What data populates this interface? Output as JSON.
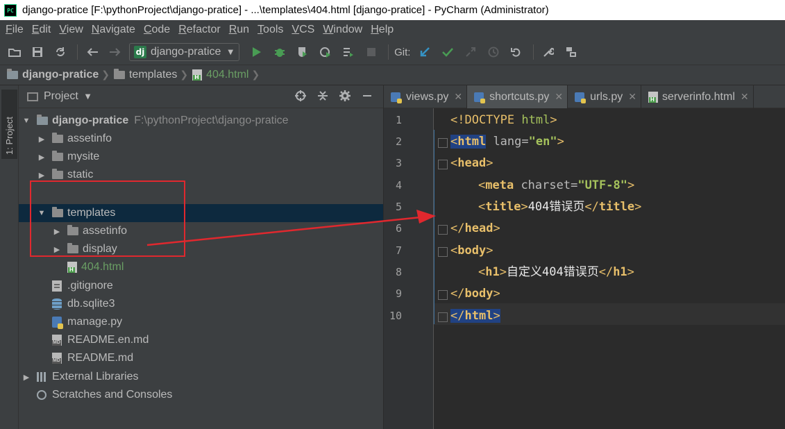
{
  "window": {
    "title": "django-pratice [F:\\pythonProject\\django-pratice] - ...\\templates\\404.html [django-pratice] - PyCharm (Administrator)",
    "app_logo_text": "PC"
  },
  "menu": [
    "File",
    "Edit",
    "View",
    "Navigate",
    "Code",
    "Refactor",
    "Run",
    "Tools",
    "VCS",
    "Window",
    "Help"
  ],
  "toolbar": {
    "run_config_badge": "dj",
    "run_config": "django-pratice",
    "git_label": "Git:"
  },
  "breadcrumb": [
    "django-pratice",
    "templates",
    "404.html"
  ],
  "left_stripe": {
    "project_tab": "1: Project"
  },
  "project_panel": {
    "title": "Project",
    "root": {
      "name": "django-pratice",
      "path": "F:\\pythonProject\\django-pratice"
    },
    "items": [
      {
        "label": "assetinfo"
      },
      {
        "label": "mysite"
      },
      {
        "label": "static"
      },
      {
        "label": "templates"
      },
      {
        "label": "assetinfo"
      },
      {
        "label": "display"
      },
      {
        "label": "404.html"
      },
      {
        "label": ".gitignore"
      },
      {
        "label": "db.sqlite3"
      },
      {
        "label": "manage.py"
      },
      {
        "label": "README.en.md"
      },
      {
        "label": "README.md"
      },
      {
        "label": "External Libraries"
      },
      {
        "label": "Scratches and Consoles"
      }
    ]
  },
  "editor_tabs": [
    {
      "label": "views.py"
    },
    {
      "label": "shortcuts.py"
    },
    {
      "label": "urls.py"
    },
    {
      "label": "serverinfo.html"
    }
  ],
  "editor": {
    "line_numbers": [
      "1",
      "2",
      "3",
      "4",
      "5",
      "6",
      "7",
      "8",
      "9",
      "10"
    ],
    "tokens": {
      "l1_doctype": "<!DOCTYPE",
      "l1_html": " html",
      "l1_close": ">",
      "lt": "<",
      "gt": ">",
      "lt_slash": "</",
      "html": "html",
      "lang_attr": " lang=",
      "lang_val": "\"en\"",
      "head": "head",
      "meta": "meta",
      "charset_attr": " charset=",
      "charset_val": "\"UTF-8\"",
      "title": "title",
      "title_text": "404错误页",
      "body": "body",
      "h1": "h1",
      "h1_text": "自定义404错误页"
    }
  },
  "colors": {
    "annotation": "#e0282e",
    "selected_row": "#0d293e",
    "highlight": "#214283"
  }
}
